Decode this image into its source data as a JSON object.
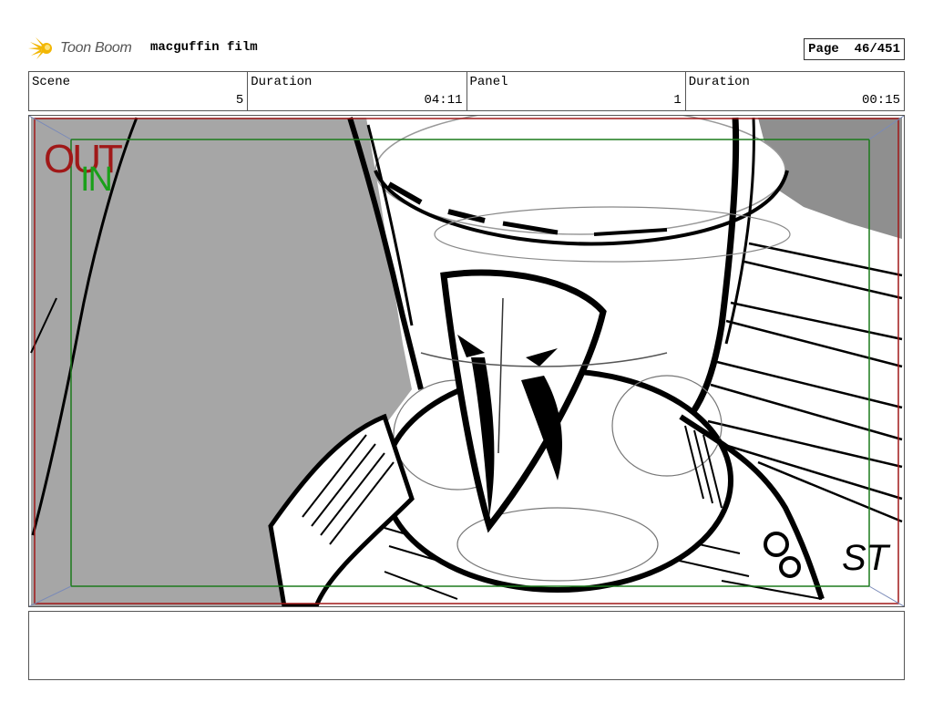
{
  "header": {
    "logo_text": "Toon Boom",
    "project_title": "macguffin film",
    "page_label": "Page",
    "page_number": "46/451"
  },
  "info": {
    "scene_label": "Scene",
    "scene_value": "5",
    "scene_duration_label": "Duration",
    "scene_duration_value": "04:11",
    "panel_label": "Panel",
    "panel_value": "1",
    "panel_duration_label": "Duration",
    "panel_duration_value": "00:15"
  },
  "frame_marks": {
    "out_label": "OUT",
    "in_label": "IN",
    "out_color": "#a01818",
    "in_color": "#1aa01a"
  },
  "sketch": {
    "corner_text": "ST"
  },
  "notes": {
    "text": ""
  }
}
